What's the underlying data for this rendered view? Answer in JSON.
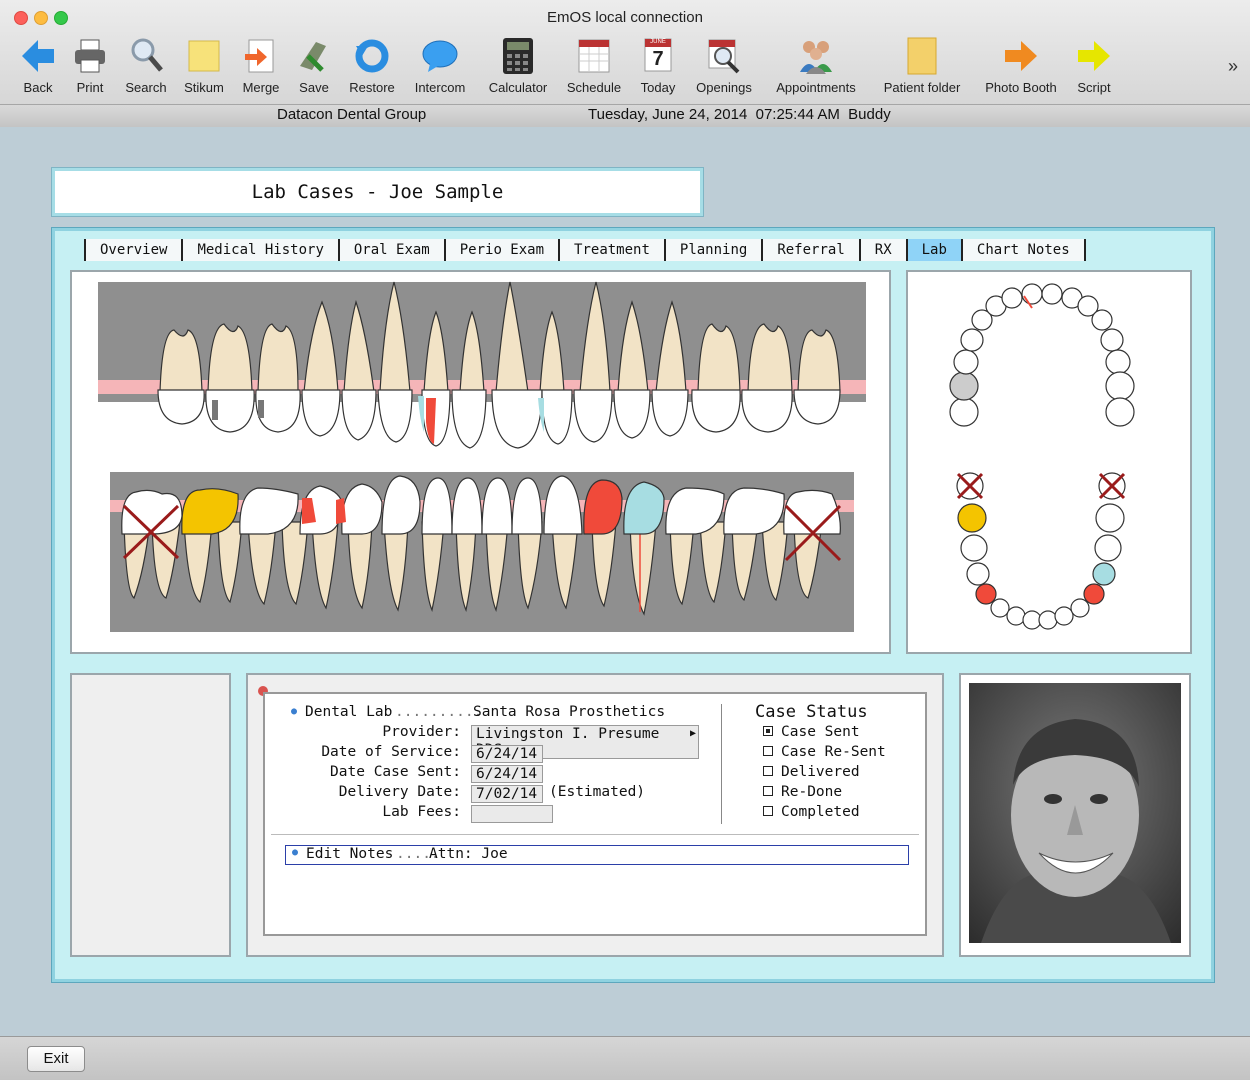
{
  "window": {
    "title": "EmOS local connection"
  },
  "toolbar": {
    "items": [
      {
        "label": "Back",
        "icon": "back-arrow-icon"
      },
      {
        "label": "Print",
        "icon": "printer-icon"
      },
      {
        "label": "Search",
        "icon": "magnifier-icon"
      },
      {
        "label": "Stikum",
        "icon": "sticky-note-icon"
      },
      {
        "label": "Merge",
        "icon": "merge-icon"
      },
      {
        "label": "Save",
        "icon": "save-icon"
      },
      {
        "label": "Restore",
        "icon": "restore-icon"
      },
      {
        "label": "Intercom",
        "icon": "speech-bubble-icon"
      },
      {
        "label": "Calculator",
        "icon": "calculator-icon"
      },
      {
        "label": "Schedule",
        "icon": "calendar-icon"
      },
      {
        "label": "Today",
        "icon": "today-calendar-icon",
        "day": "7",
        "month": "JUNE"
      },
      {
        "label": "Openings",
        "icon": "openings-icon"
      },
      {
        "label": "Appointments",
        "icon": "people-icon"
      },
      {
        "label": "Patient folder",
        "icon": "folder-icon"
      },
      {
        "label": "Photo Booth",
        "icon": "orange-arrow-icon"
      },
      {
        "label": "Script",
        "icon": "yellow-arrow-icon"
      }
    ],
    "overflow": "»"
  },
  "infobar": {
    "practice": "Datacon Dental Group",
    "datetime": "Tuesday, June 24, 2014  07:25:44 AM  Buddy"
  },
  "page": {
    "title": "Lab Cases - Joe Sample"
  },
  "tabs": [
    {
      "label": "Overview",
      "active": false
    },
    {
      "label": "Medical History",
      "active": false
    },
    {
      "label": "Oral Exam",
      "active": false
    },
    {
      "label": "Perio Exam",
      "active": false
    },
    {
      "label": "Treatment",
      "active": false
    },
    {
      "label": "Planning",
      "active": false
    },
    {
      "label": "Referral",
      "active": false
    },
    {
      "label": "RX",
      "active": false
    },
    {
      "label": "Lab",
      "active": true
    },
    {
      "label": "Chart Notes",
      "active": false
    }
  ],
  "lab": {
    "dental_lab_label": "Dental Lab",
    "dental_lab_value": "Santa Rosa Prosthetics",
    "provider_label": "Provider:",
    "provider_value": "Livingston I. Presume DDS",
    "date_service_label": "Date of Service:",
    "date_service_value": "6/24/14",
    "date_sent_label": "Date Case Sent:",
    "date_sent_value": "6/24/14",
    "delivery_label": "Delivery Date:",
    "delivery_value": "7/02/14",
    "delivery_note": "(Estimated)",
    "fees_label": "Lab Fees:",
    "fees_value": "",
    "notes_label": "Edit Notes",
    "notes_value": "Attn: Joe"
  },
  "case_status": {
    "title": "Case Status",
    "options": [
      {
        "label": "Case Sent",
        "checked": true
      },
      {
        "label": "Case Re-Sent",
        "checked": false
      },
      {
        "label": "Delivered",
        "checked": false
      },
      {
        "label": "Re-Done",
        "checked": false
      },
      {
        "label": "Completed",
        "checked": false
      }
    ]
  },
  "footer": {
    "exit_label": "Exit"
  },
  "colors": {
    "panel": "#c6f0f3",
    "active_tab": "#8fd3f7",
    "tooth_red": "#f04a3a",
    "tooth_yellow": "#f4c400",
    "tooth_teal": "#a7dde2",
    "gum": "#f5b5b8"
  }
}
